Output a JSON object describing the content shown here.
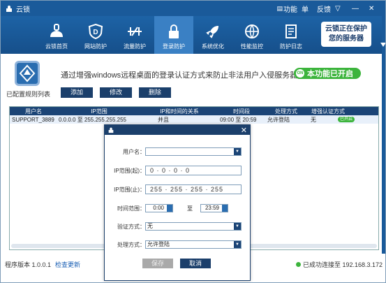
{
  "titlebar": {
    "title": "云锁",
    "menu_label": "功能",
    "menu_suffix": "单",
    "feedback_label": "反馈",
    "dropdown_glyph": "▽",
    "min_glyph": "—",
    "close_glyph": "✕"
  },
  "toolbar": {
    "items": [
      {
        "label": "云锁首页",
        "icon": "home-icon"
      },
      {
        "label": "网站防护",
        "icon": "shield-d-icon"
      },
      {
        "label": "流量防护",
        "icon": "traffic-icon"
      },
      {
        "label": "登录防护",
        "icon": "lock-icon"
      },
      {
        "label": "系统优化",
        "icon": "rocket-icon"
      },
      {
        "label": "性能监控",
        "icon": "globe-icon"
      },
      {
        "label": "防护日志",
        "icon": "log-icon"
      }
    ],
    "protect_line1": "云锁正在保护",
    "protect_line2": "您的服务器"
  },
  "header": {
    "description": "通过增强windows远程桌面的登录认证方式来防止非法用户入侵服务器",
    "status_badge": "本功能已开启",
    "status_dot": "ON",
    "rules_label": "已配置规则列表",
    "add_button": "添加",
    "edit_button": "修改",
    "delete_button": "删除"
  },
  "table": {
    "columns": [
      "用户名",
      "IP范围",
      "IP和时间的关系",
      "时间段",
      "处理方式",
      "增强认证方式"
    ],
    "rows": [
      {
        "username": "SUPPORT_3889",
        "ip_range": "0.0.0.0 至 255.255.255.255",
        "relation": "并且",
        "time": "09:00 至 20:59",
        "action": "允许登陆",
        "auth": "无",
        "state": "已开启"
      }
    ]
  },
  "status": {
    "version": "程序版本 1.0.0.1",
    "update_link": "检查更新",
    "connection": "已成功连接至 192.168.3.172"
  },
  "dialog": {
    "close_glyph": "✕",
    "username_label": "用户名：",
    "username_value": "",
    "ip_start_label": "IP范围(起)：",
    "ip_start_value": "0  ·  0  ·  0  ·  0",
    "ip_end_label": "IP范围(止)：",
    "ip_end_value": "255 · 255 · 255 · 255",
    "time_label": "时间范围：",
    "time_start": "0:00",
    "time_to": "至",
    "time_end": "23:59",
    "auth_label": "验证方式：",
    "auth_value": "无",
    "action_label": "处理方式：",
    "action_value": "允许登陆",
    "save_button": "保存",
    "cancel_button": "取消"
  },
  "colors": {
    "title_bg": "#1a5a9a",
    "toolbar_bg": "#1d63a6",
    "active_tab": "#3a80c4",
    "navy": "#1b3f6b",
    "green": "#3cb43c"
  }
}
